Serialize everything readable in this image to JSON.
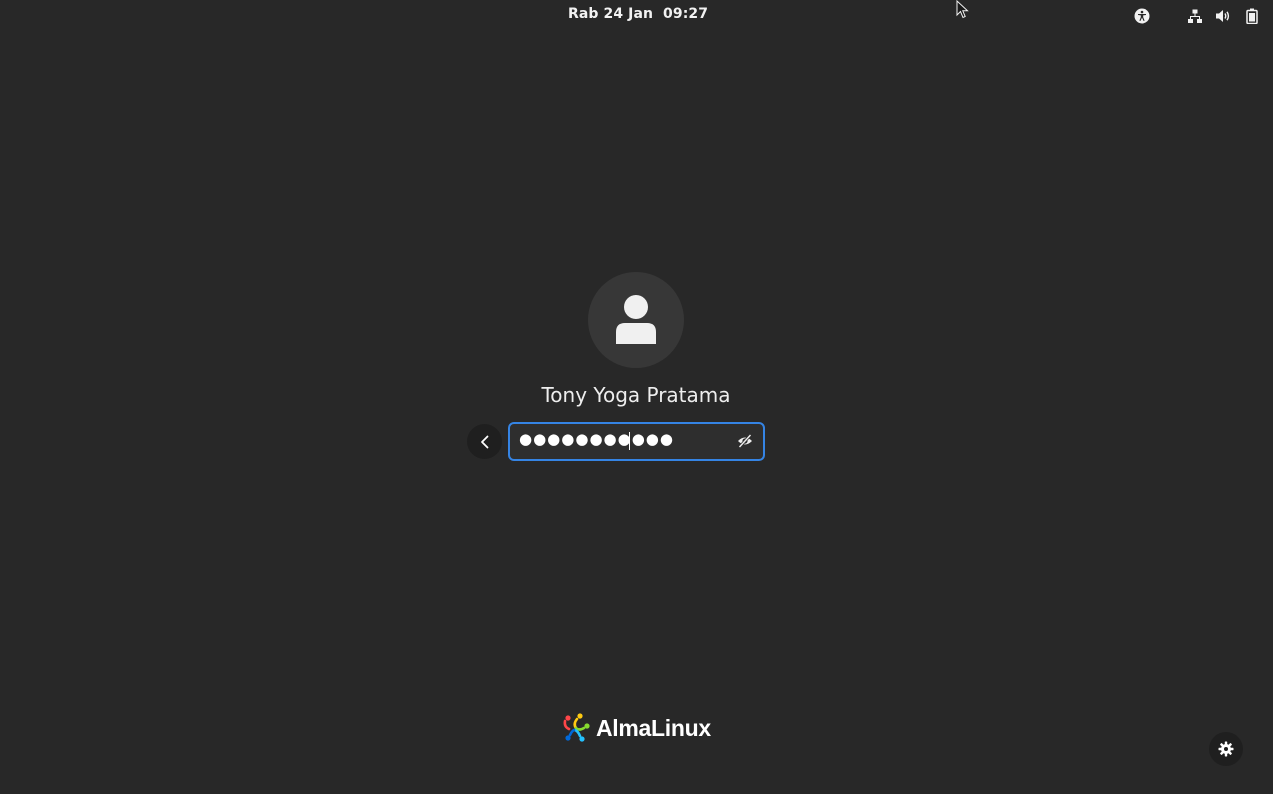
{
  "topbar": {
    "clock": "Rab 24 Jan  09:27",
    "icons": [
      "accessibility-icon",
      "network-wired-icon",
      "volume-icon",
      "battery-icon"
    ]
  },
  "login": {
    "user_name": "Tony Yoga Pratama",
    "password_mask": "●●●●●●●●●●●",
    "back_icon": "chevron-left-icon",
    "peek_icon": "eye-off-icon",
    "avatar_icon": "user-icon"
  },
  "branding": {
    "logo_text": "AlmaLinux"
  },
  "settings": {
    "icon": "gear-icon"
  },
  "colors": {
    "background": "#282828",
    "accent": "#3584e4",
    "avatar_bg": "#373737"
  }
}
